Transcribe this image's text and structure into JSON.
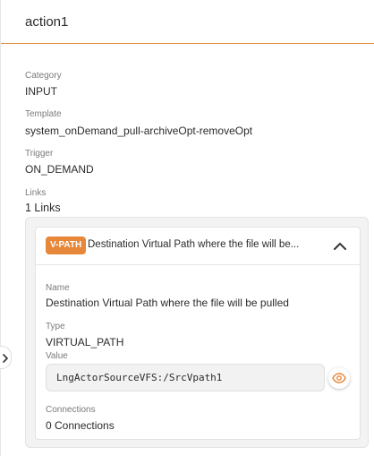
{
  "header": {
    "title": "action1"
  },
  "fields": {
    "category": {
      "label": "Category",
      "value": "INPUT"
    },
    "template": {
      "label": "Template",
      "value": "system_onDemand_pull-archiveOpt-removeOpt"
    },
    "trigger": {
      "label": "Trigger",
      "value": "ON_DEMAND"
    },
    "links": {
      "label": "Links",
      "value": "1 Links"
    }
  },
  "link_card": {
    "badge": "V-PATH",
    "title": "Destination Virtual Path where the file will be...",
    "name_label": "Name",
    "name_value": "Destination Virtual Path where the file will be pulled",
    "type_label": "Type",
    "type_value": "VIRTUAL_PATH",
    "value_label": "Value",
    "value_value": "LngActorSourceVFS:/SrcVpath1",
    "connections_label": "Connections",
    "connections_value": "0 Connections"
  },
  "icons": {
    "collapse": "chevron-up-icon",
    "reveal": "eye-icon",
    "side_toggle": "chevron-right-icon"
  },
  "colors": {
    "accent": "#e6873a",
    "header_rule": "#e08a3c"
  }
}
